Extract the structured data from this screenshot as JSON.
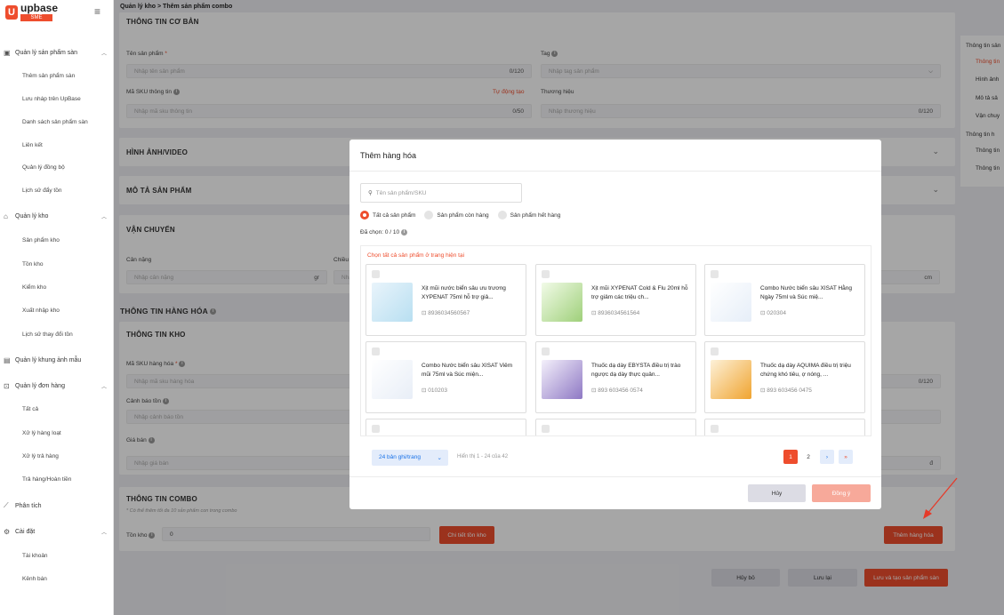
{
  "app": {
    "logo_letter": "U",
    "name": "upbase",
    "badge": "SME"
  },
  "breadcrumb": "Quản lý kho > Thêm sản phẩm combo",
  "sidebar": {
    "groups": [
      {
        "label": "Quản lý sản phẩm sàn",
        "items": [
          "Thêm sản phẩm sàn",
          "Lưu nháp trên UpBase",
          "Danh sách sản phẩm sàn",
          "Liên kết",
          "Quản lý đồng bộ",
          "Lịch sử đẩy tồn"
        ]
      },
      {
        "label": "Quản lý kho",
        "items": [
          "Sản phẩm kho",
          "Tồn kho",
          "Kiểm kho",
          "Xuất nhập kho",
          "Lịch sử thay đổi tồn"
        ]
      },
      {
        "label": "Quản lý khung ảnh mẫu",
        "items": []
      },
      {
        "label": "Quản lý đơn hàng",
        "items": [
          "Tất cả",
          "Xử lý hàng loạt",
          "Xử lý trả hàng",
          "Trả hàng/Hoàn tiền"
        ]
      },
      {
        "label": "Phân tích",
        "items": []
      },
      {
        "label": "Cài đặt",
        "items": [
          "Tài khoản",
          "Kênh bán"
        ]
      }
    ]
  },
  "form": {
    "basic_title": "THÔNG TIN CƠ BẢN",
    "name_label": "Tên sản phẩm",
    "name_placeholder": "Nhập tên sản phẩm",
    "name_count": "0/120",
    "tag_label": "Tag",
    "tag_placeholder": "Nhập tag sản phẩm",
    "sku_label": "Mã SKU thông tin",
    "sku_auto": "Tự động tạo",
    "sku_placeholder": "Nhập mã sku thông tin",
    "sku_count": "0/50",
    "brand_label": "Thương hiệu",
    "brand_placeholder": "Nhập thương hiệu",
    "brand_count": "0/120",
    "media_title": "HÌNH ẢNH/VIDEO",
    "desc_title": "MÔ TẢ SẢN PHẨM",
    "ship_title": "VẬN CHUYỂN",
    "weight_label": "Cân nặng",
    "weight_placeholder": "Nhập cân nặng",
    "weight_unit": "gr",
    "size_label": "Chiều",
    "size_placeholder": "Nhậ",
    "size_unit": "cm",
    "goods_title": "THÔNG TIN HÀNG HÓA",
    "stock_title": "THÔNG TIN KHO",
    "stock_sku_label": "Mã SKU hàng hóa",
    "stock_sku_placeholder": "Nhập mã sku hàng hóa",
    "stock_sku_count": "0/120",
    "stock_alert_label": "Cảnh báo tồn",
    "stock_alert_placeholder": "Nhập cảnh báo tồn",
    "price_label": "Giá bán",
    "price_placeholder": "Nhập giá bán",
    "price_unit": "đ",
    "combo_title": "THÔNG TIN COMBO",
    "combo_note": "* Có thể thêm tối đa 10 sản phẩm con trong combo",
    "stock_qty_label": "Tồn kho",
    "stock_qty_value": "0",
    "stock_detail_btn": "Chi tiết tồn kho",
    "add_goods_btn": "Thêm hàng hóa",
    "cancel_btn": "Hủy bỏ",
    "save_btn": "Lưu lại",
    "save_create_btn": "Lưu và tạo sản phẩm sàn"
  },
  "right_nav": {
    "items": [
      "Thông tin sản",
      "Thông tin",
      "Hình ảnh",
      "Mô tả sả",
      "Vận chuy",
      "Thông tin h",
      "Thông tin",
      "Thông tin"
    ]
  },
  "modal": {
    "title": "Thêm hàng hóa",
    "search_placeholder": "Tên sản phẩm/SKU",
    "filters": [
      "Tất cả sản phẩm",
      "Sản phẩm còn hàng",
      "Sản phẩm hết hàng"
    ],
    "chosen": "Đã chọn: 0 / 10",
    "select_all": "Chọn tất cả sản phẩm ở trang hiện tại",
    "products": [
      {
        "name": "Xịt mũi nước biển sâu ưu trương XYPENAT 75ml hỗ trợ giả...",
        "sku": "8936034560567"
      },
      {
        "name": "Xịt mũi XYPENAT Cold & Flu 20ml hỗ trợ giảm các triệu ch...",
        "sku": "8936034561564"
      },
      {
        "name": "Combo Nước biển sâu XISAT Hằng Ngày 75ml và Súc miệ...",
        "sku": "020304"
      },
      {
        "name": "Combo Nước biển sâu XISAT Viêm mũi 75ml và Súc miện...",
        "sku": "010203"
      },
      {
        "name": "Thuốc dạ dày EBYSTA điều trị trào ngược dạ dày thực quản...",
        "sku": "893 603456 0574"
      },
      {
        "name": "Thuốc dạ dày AQUIMA điều trị triệu chứng khó tiêu, ợ nóng, ...",
        "sku": "893 603456 0475"
      }
    ],
    "per_page": "24 bản ghi/trang",
    "showing": "Hiển thị 1 - 24 của 42",
    "pages": [
      "1",
      "2"
    ],
    "next": "›",
    "last": "»",
    "cancel": "Hủy",
    "confirm": "Đồng ý"
  },
  "colors": {
    "accent": "#ee4d2d",
    "link": "#1a73e8"
  }
}
